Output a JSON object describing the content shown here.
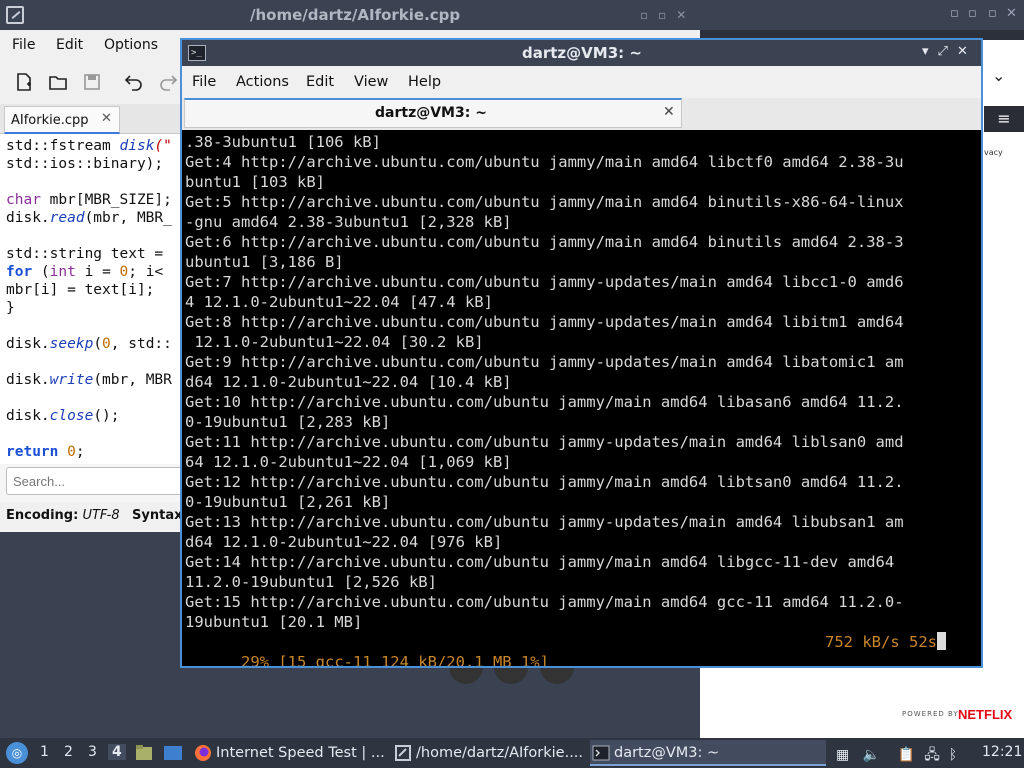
{
  "browser": {
    "privacy_fragment": "vacy",
    "powered_by": "POWERED BY",
    "netflix": "NETFLIX"
  },
  "editor": {
    "window_title": "/home/dartz/AIforkie.cpp",
    "menu": [
      "File",
      "Edit",
      "Options"
    ],
    "tab_label": "AIforkie.cpp",
    "tab_close": "✕",
    "search_placeholder": "Search...",
    "status_encoding_label": "Encoding:",
    "status_encoding_value": "UTF-8",
    "status_syntax_label": "Syntax:",
    "code": {
      "l1a": "std::fstream ",
      "l1b": "disk",
      "l1c": "(\"",
      "l2": "std::ios::binary);",
      "l4a": "char",
      "l4b": " mbr[MBR_SIZE];",
      "l5a": "disk.",
      "l5b": "read",
      "l5c": "(mbr, MBR_",
      "l7a": "std::string",
      "l7b": " text =",
      "l8a": "for",
      "l8b": " (",
      "l8c": "int",
      "l8d": " i = ",
      "l8e": "0",
      "l8f": "; i< ",
      "l9": "mbr[i] = text[i];",
      "l10": "}",
      "l12a": "disk.",
      "l12b": "seekp",
      "l12c": "(",
      "l12d": "0",
      "l12e": ", std::",
      "l14a": "disk.",
      "l14b": "write",
      "l14c": "(mbr, MBR",
      "l16a": "disk.",
      "l16b": "close",
      "l16c": "();",
      "l18a": "return",
      "l18b": " ",
      "l18c": "0",
      "l18d": ";"
    }
  },
  "terminal": {
    "window_title": "dartz@VM3: ~",
    "tab_label": "dartz@VM3: ~",
    "tab_close": "✕",
    "menu": [
      "File",
      "Actions",
      "Edit",
      "View",
      "Help"
    ],
    "lines": [
      ".38-3ubuntu1 [106 kB]",
      "Get:4 http://archive.ubuntu.com/ubuntu jammy/main amd64 libctf0 amd64 2.38-3u",
      "buntu1 [103 kB]",
      "Get:5 http://archive.ubuntu.com/ubuntu jammy/main amd64 binutils-x86-64-linux",
      "-gnu amd64 2.38-3ubuntu1 [2,328 kB]",
      "Get:6 http://archive.ubuntu.com/ubuntu jammy/main amd64 binutils amd64 2.38-3",
      "ubuntu1 [3,186 B]",
      "Get:7 http://archive.ubuntu.com/ubuntu jammy-updates/main amd64 libcc1-0 amd6",
      "4 12.1.0-2ubuntu1~22.04 [47.4 kB]",
      "Get:8 http://archive.ubuntu.com/ubuntu jammy-updates/main amd64 libitm1 amd64",
      " 12.1.0-2ubuntu1~22.04 [30.2 kB]",
      "Get:9 http://archive.ubuntu.com/ubuntu jammy-updates/main amd64 libatomic1 am",
      "d64 12.1.0-2ubuntu1~22.04 [10.4 kB]",
      "Get:10 http://archive.ubuntu.com/ubuntu jammy/main amd64 libasan6 amd64 11.2.",
      "0-19ubuntu1 [2,283 kB]",
      "Get:11 http://archive.ubuntu.com/ubuntu jammy-updates/main amd64 liblsan0 amd",
      "64 12.1.0-2ubuntu1~22.04 [1,069 kB]",
      "Get:12 http://archive.ubuntu.com/ubuntu jammy/main amd64 libtsan0 amd64 11.2.",
      "0-19ubuntu1 [2,261 kB]",
      "Get:13 http://archive.ubuntu.com/ubuntu jammy-updates/main amd64 libubsan1 am",
      "d64 12.1.0-2ubuntu1~22.04 [976 kB]",
      "Get:14 http://archive.ubuntu.com/ubuntu jammy/main amd64 libgcc-11-dev amd64",
      "11.2.0-19ubuntu1 [2,526 kB]",
      "Get:15 http://archive.ubuntu.com/ubuntu jammy/main amd64 gcc-11 amd64 11.2.0-",
      "19ubuntu1 [20.1 MB]"
    ],
    "progress": "29% [15 gcc-11 124 kB/20.1 MB 1%]",
    "speed": "752 kB/s 52s"
  },
  "taskbar": {
    "workspaces": [
      "1",
      "2",
      "3",
      "4"
    ],
    "active_workspace": "4",
    "tasks": [
      {
        "label": "Internet Speed Test | ...",
        "icon": "firefox-icon"
      },
      {
        "label": "/home/dartz/AIforkie....",
        "icon": "editor-icon"
      },
      {
        "label": "dartz@VM3: ~",
        "icon": "terminal-icon"
      }
    ],
    "clock": "12:21"
  },
  "colors": {
    "titlebar": "#3b4252",
    "taskbar": "#2e3440",
    "terminal_bg": "#000000",
    "progress_text": "#c8862a",
    "focus_border": "#4a90d9",
    "netflix_red": "#e50914"
  }
}
